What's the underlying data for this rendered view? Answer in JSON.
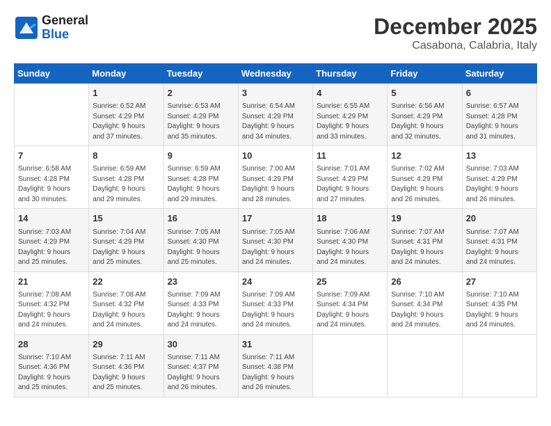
{
  "header": {
    "logo_line1": "General",
    "logo_line2": "Blue",
    "month": "December 2025",
    "location": "Casabona, Calabria, Italy"
  },
  "weekdays": [
    "Sunday",
    "Monday",
    "Tuesday",
    "Wednesday",
    "Thursday",
    "Friday",
    "Saturday"
  ],
  "weeks": [
    [
      {
        "day": "",
        "info": ""
      },
      {
        "day": "1",
        "info": "Sunrise: 6:52 AM\nSunset: 4:29 PM\nDaylight: 9 hours\nand 37 minutes."
      },
      {
        "day": "2",
        "info": "Sunrise: 6:53 AM\nSunset: 4:29 PM\nDaylight: 9 hours\nand 35 minutes."
      },
      {
        "day": "3",
        "info": "Sunrise: 6:54 AM\nSunset: 4:29 PM\nDaylight: 9 hours\nand 34 minutes."
      },
      {
        "day": "4",
        "info": "Sunrise: 6:55 AM\nSunset: 4:29 PM\nDaylight: 9 hours\nand 33 minutes."
      },
      {
        "day": "5",
        "info": "Sunrise: 6:56 AM\nSunset: 4:29 PM\nDaylight: 9 hours\nand 32 minutes."
      },
      {
        "day": "6",
        "info": "Sunrise: 6:57 AM\nSunset: 4:28 PM\nDaylight: 9 hours\nand 31 minutes."
      }
    ],
    [
      {
        "day": "7",
        "info": "Sunrise: 6:58 AM\nSunset: 4:28 PM\nDaylight: 9 hours\nand 30 minutes."
      },
      {
        "day": "8",
        "info": "Sunrise: 6:59 AM\nSunset: 4:28 PM\nDaylight: 9 hours\nand 29 minutes."
      },
      {
        "day": "9",
        "info": "Sunrise: 6:59 AM\nSunset: 4:28 PM\nDaylight: 9 hours\nand 29 minutes."
      },
      {
        "day": "10",
        "info": "Sunrise: 7:00 AM\nSunset: 4:29 PM\nDaylight: 9 hours\nand 28 minutes."
      },
      {
        "day": "11",
        "info": "Sunrise: 7:01 AM\nSunset: 4:29 PM\nDaylight: 9 hours\nand 27 minutes."
      },
      {
        "day": "12",
        "info": "Sunrise: 7:02 AM\nSunset: 4:29 PM\nDaylight: 9 hours\nand 26 minutes."
      },
      {
        "day": "13",
        "info": "Sunrise: 7:03 AM\nSunset: 4:29 PM\nDaylight: 9 hours\nand 26 minutes."
      }
    ],
    [
      {
        "day": "14",
        "info": "Sunrise: 7:03 AM\nSunset: 4:29 PM\nDaylight: 9 hours\nand 25 minutes."
      },
      {
        "day": "15",
        "info": "Sunrise: 7:04 AM\nSunset: 4:29 PM\nDaylight: 9 hours\nand 25 minutes."
      },
      {
        "day": "16",
        "info": "Sunrise: 7:05 AM\nSunset: 4:30 PM\nDaylight: 9 hours\nand 25 minutes."
      },
      {
        "day": "17",
        "info": "Sunrise: 7:05 AM\nSunset: 4:30 PM\nDaylight: 9 hours\nand 24 minutes."
      },
      {
        "day": "18",
        "info": "Sunrise: 7:06 AM\nSunset: 4:30 PM\nDaylight: 9 hours\nand 24 minutes."
      },
      {
        "day": "19",
        "info": "Sunrise: 7:07 AM\nSunset: 4:31 PM\nDaylight: 9 hours\nand 24 minutes."
      },
      {
        "day": "20",
        "info": "Sunrise: 7:07 AM\nSunset: 4:31 PM\nDaylight: 9 hours\nand 24 minutes."
      }
    ],
    [
      {
        "day": "21",
        "info": "Sunrise: 7:08 AM\nSunset: 4:32 PM\nDaylight: 9 hours\nand 24 minutes."
      },
      {
        "day": "22",
        "info": "Sunrise: 7:08 AM\nSunset: 4:32 PM\nDaylight: 9 hours\nand 24 minutes."
      },
      {
        "day": "23",
        "info": "Sunrise: 7:09 AM\nSunset: 4:33 PM\nDaylight: 9 hours\nand 24 minutes."
      },
      {
        "day": "24",
        "info": "Sunrise: 7:09 AM\nSunset: 4:33 PM\nDaylight: 9 hours\nand 24 minutes."
      },
      {
        "day": "25",
        "info": "Sunrise: 7:09 AM\nSunset: 4:34 PM\nDaylight: 9 hours\nand 24 minutes."
      },
      {
        "day": "26",
        "info": "Sunrise: 7:10 AM\nSunset: 4:34 PM\nDaylight: 9 hours\nand 24 minutes."
      },
      {
        "day": "27",
        "info": "Sunrise: 7:10 AM\nSunset: 4:35 PM\nDaylight: 9 hours\nand 24 minutes."
      }
    ],
    [
      {
        "day": "28",
        "info": "Sunrise: 7:10 AM\nSunset: 4:36 PM\nDaylight: 9 hours\nand 25 minutes."
      },
      {
        "day": "29",
        "info": "Sunrise: 7:11 AM\nSunset: 4:36 PM\nDaylight: 9 hours\nand 25 minutes."
      },
      {
        "day": "30",
        "info": "Sunrise: 7:11 AM\nSunset: 4:37 PM\nDaylight: 9 hours\nand 26 minutes."
      },
      {
        "day": "31",
        "info": "Sunrise: 7:11 AM\nSunset: 4:38 PM\nDaylight: 9 hours\nand 26 minutes."
      },
      {
        "day": "",
        "info": ""
      },
      {
        "day": "",
        "info": ""
      },
      {
        "day": "",
        "info": ""
      }
    ]
  ]
}
